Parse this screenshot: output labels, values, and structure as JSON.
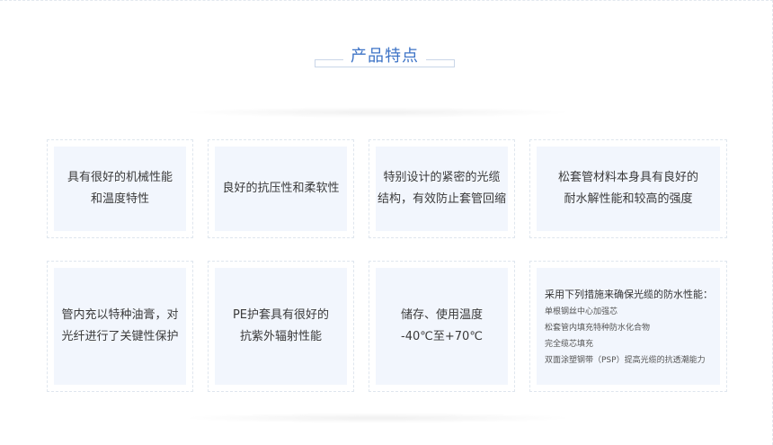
{
  "section": {
    "title": "产品特点"
  },
  "features_row1": [
    {
      "lines": [
        "具有很好的机械性能",
        "和温度特性"
      ]
    },
    {
      "lines": [
        "良好的抗压性和柔软性"
      ]
    },
    {
      "lines": [
        "特别设计的紧密的光缆",
        "结构，有效防止套管回缩"
      ]
    },
    {
      "lines": [
        "松套管材料本身具有良好的",
        "耐水解性能和较高的强度"
      ]
    }
  ],
  "features_row2": [
    {
      "lines": [
        "管内充以特种油膏，对",
        "光纤进行了关键性保护"
      ]
    },
    {
      "lines": [
        "PE护套具有很好的",
        "抗紫外辐射性能"
      ]
    },
    {
      "lines": [
        "储存、使用温度",
        "-40℃至+70℃"
      ]
    }
  ],
  "waterproof": {
    "heading": "采用下列措施来确保光缆的防水性能：",
    "items": [
      "单根钢丝中心加强芯",
      "松套管内填充特种防水化合物",
      "完全缆芯填充",
      "双面涂塑钢带（PSP）提高光缆的抗透潮能力"
    ]
  }
}
